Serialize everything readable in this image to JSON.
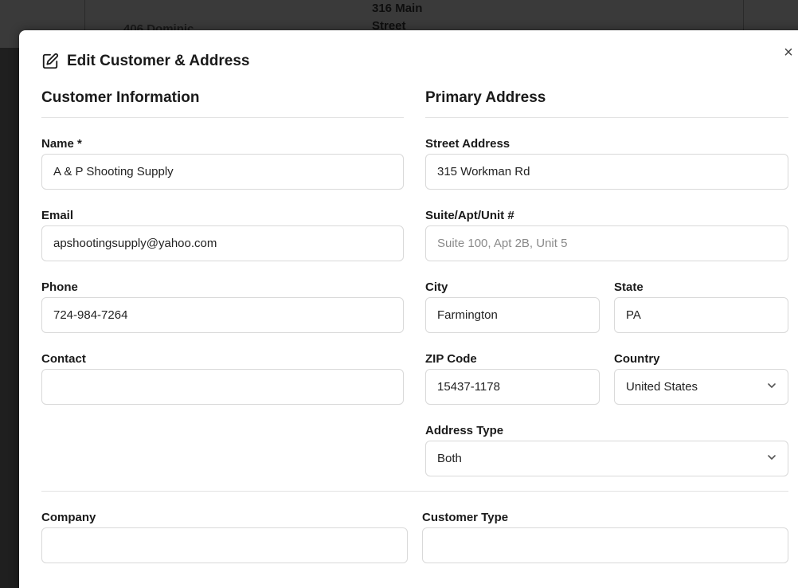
{
  "background": {
    "cell_street": "316 Main Street",
    "cell_partial": "406 Dominic"
  },
  "modal": {
    "title": "Edit Customer & Address",
    "close_label": "×"
  },
  "customer": {
    "section_title": "Customer Information",
    "name_label": "Name *",
    "name_value": "A & P Shooting Supply",
    "email_label": "Email",
    "email_value": "apshootingsupply@yahoo.com",
    "phone_label": "Phone",
    "phone_value": "724-984-7264",
    "contact_label": "Contact",
    "contact_value": ""
  },
  "address": {
    "section_title": "Primary Address",
    "street_label": "Street Address",
    "street_value": "315 Workman Rd",
    "suite_label": "Suite/Apt/Unit #",
    "suite_placeholder": "Suite 100, Apt 2B, Unit 5",
    "city_label": "City",
    "city_value": "Farmington",
    "state_label": "State",
    "state_value": "PA",
    "zip_label": "ZIP Code",
    "zip_value": "15437-1178",
    "country_label": "Country",
    "country_value": "United States",
    "type_label": "Address Type",
    "type_value": "Both"
  },
  "extra": {
    "company_label": "Company",
    "customer_type_label": "Customer Type"
  }
}
